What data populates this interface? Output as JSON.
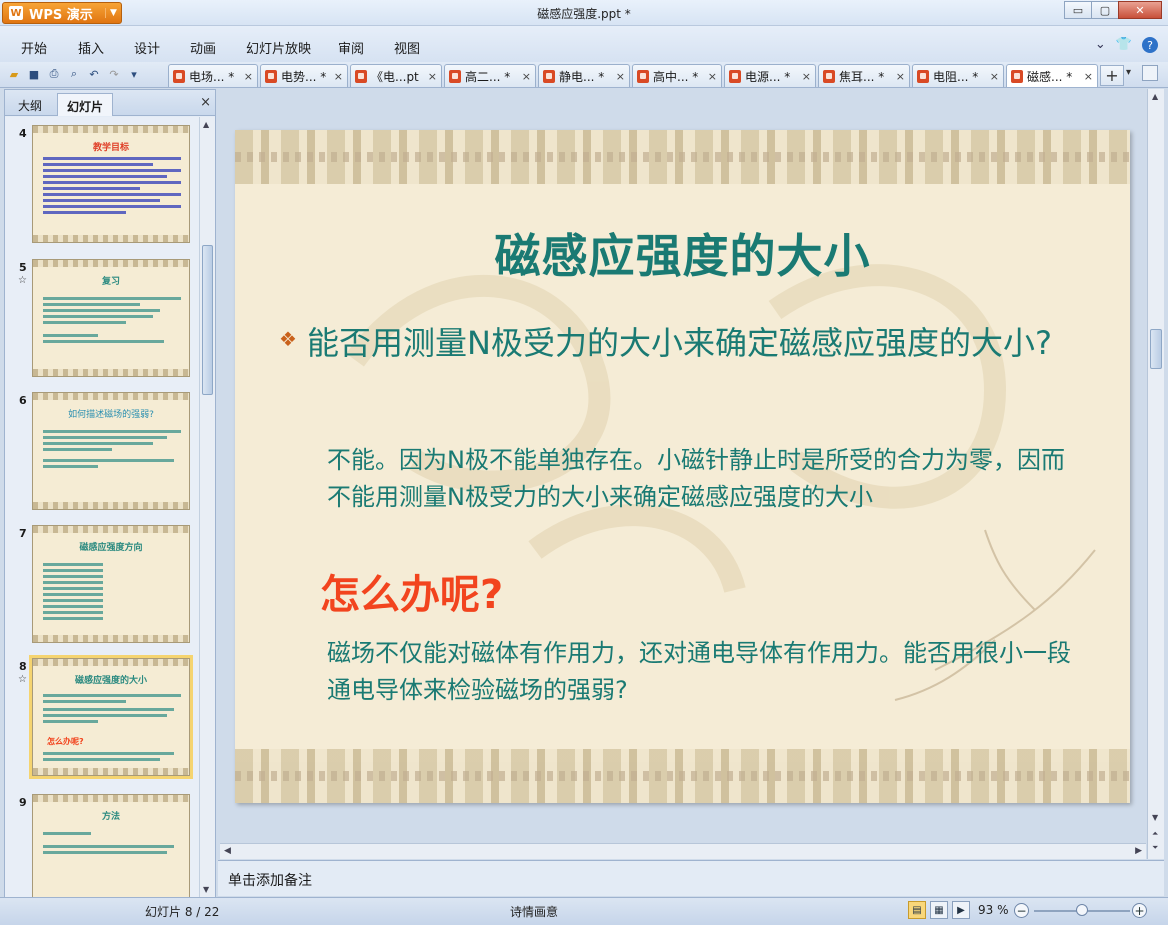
{
  "app": {
    "name": "WPS 演示",
    "logo": "W",
    "doc_title": "磁感应强度.ppt *"
  },
  "window_controls": {
    "minimize": "▭",
    "restore": "▢",
    "close": "✕"
  },
  "menu": [
    "开始",
    "插入",
    "设计",
    "动画",
    "幻灯片放映",
    "审阅",
    "视图"
  ],
  "tabs": [
    {
      "label": "电场... *"
    },
    {
      "label": "电势... *"
    },
    {
      "label": "《电...pt"
    },
    {
      "label": "高二... *"
    },
    {
      "label": "静电... *"
    },
    {
      "label": "高中... *"
    },
    {
      "label": "电源... *"
    },
    {
      "label": "焦耳... *"
    },
    {
      "label": "电阻... *"
    },
    {
      "label": "磁感... *"
    }
  ],
  "tab_close": "×",
  "tab_add": "+",
  "panel": {
    "tab_outline": "大纲",
    "tab_slides": "幻灯片",
    "close": "×"
  },
  "thumbnails": [
    {
      "num": "4",
      "title": "教学目标",
      "star": ""
    },
    {
      "num": "5",
      "title": "复习",
      "star": "☆"
    },
    {
      "num": "6",
      "title": "如何描述磁场的强弱?",
      "star": ""
    },
    {
      "num": "7",
      "title": "磁感应强度方向",
      "star": ""
    },
    {
      "num": "8",
      "title": "磁感应强度的大小",
      "star": "☆",
      "extra": "怎么办呢?"
    },
    {
      "num": "9",
      "title": "方法",
      "star": ""
    }
  ],
  "slide": {
    "title": "磁感应强度的大小",
    "bullet": "❖",
    "question": "能否用测量N极受力的大小来确定磁感应强度的大小?",
    "answer": "不能。因为N极不能单独存在。小磁针静止时是所受的合力为零，因而不能用测量N极受力的大小来确定磁感应强度的大小",
    "howto": "怎么办呢?",
    "paragraph": "磁场不仅能对磁体有作用力，还对通电导体有作用力。能否用很小一段通电导体来检验磁场的强弱?"
  },
  "notes_placeholder": "单击添加备注",
  "status": {
    "slide_counter": "幻灯片 8 / 22",
    "theme": "诗情画意",
    "zoom": "93 %",
    "zoom_fraction": 0.5
  },
  "colors": {
    "accent": "#1a7a73",
    "highlight": "#f2441e",
    "app_orange": "#e07511"
  }
}
